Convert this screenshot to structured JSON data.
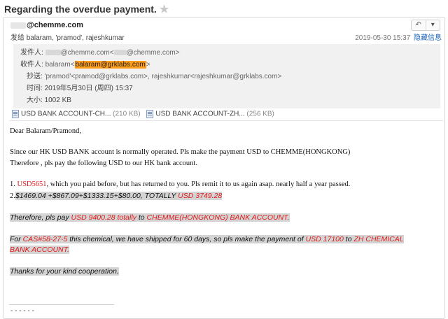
{
  "subject": "Regarding the overdue  payment.",
  "header": {
    "sender_email": "@chemme.com",
    "sent_to": "发给 balaram, 'pramod', rajeshkumar",
    "date": "2019-05-30 15:37",
    "hide_info": "隐藏信息"
  },
  "details": {
    "from_label": "发件人:",
    "from_value_a": "@chemme.com<",
    "from_value_b": "@chemme.com>",
    "to_label": "收件人:",
    "to_name": "balaram<",
    "to_email": "balaram@grklabs.com",
    "to_end": ">",
    "cc_label": "抄送:",
    "cc_value": "'pramod'<pramod@grklabs.com>,  rajeshkumar<rajeshkumar@grklabs.com>",
    "time_label": "时间:",
    "time_value": "2019年5月30日 (周四) 15:37",
    "size_label": "大小:",
    "size_value": "1002 KB"
  },
  "attachments": [
    {
      "name": "USD BANK ACCOUNT-CH...",
      "size": "(210 KB)"
    },
    {
      "name": "USD BANK ACCOUNT-ZH...",
      "size": "(256 KB)"
    }
  ],
  "body": {
    "greeting": "Dear Balaram/Pramond,",
    "para1_line1": "Since our HK USD BANK account is normally operated. Pls make the payment USD to CHEMME(HONGKONG)",
    "para1_line2": "Therefore , pls pay the following USD to our HK bank account.",
    "item1_num": "1.  ",
    "item1_amount": "USD5651",
    "item1_text": ",  which you paid before, but has returned to you. Pls remit it to us again asap. nearly half a year passed.",
    "item2_num": "2.",
    "item2_text": "$1469.04 +$867.09+$1333.15+$80.00,    TOTALLY ",
    "item2_total": "USD 3749.28",
    "therefore_a": "Therefore, pls pay ",
    "therefore_amount": "USD 9400.28 totally",
    "therefore_b": "  to ",
    "therefore_account": "CHEMME(HONGKONG) BANK ACCOUNT.",
    "cas_a": "For ",
    "cas_number": "CAS#58-27-5",
    "cas_b": " this chemical, we have shipped for  60 days, so pls make the payment of ",
    "cas_amount": "USD 17100",
    "cas_c": " to ",
    "cas_account_1": "ZH CHEMICAL",
    "cas_account_2": "BANK ACCOUNT.",
    "thanks": "Thanks for your kind cooperation."
  },
  "footer_dots": "- - - - - -"
}
